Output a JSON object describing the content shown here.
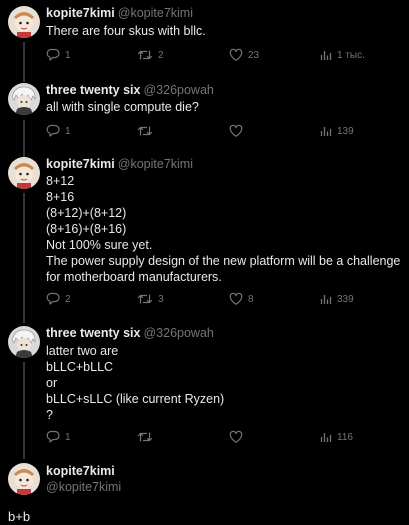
{
  "tweets": [
    {
      "name": "kopite7kimi",
      "handle": "@kopite7kimi",
      "lines": [
        "There are four skus with bllc."
      ],
      "replies": "1",
      "retweets": "2",
      "likes": "23",
      "views": "1 тыс."
    },
    {
      "name": "three twenty six",
      "handle": "@326powah",
      "lines": [
        "all with single compute die?"
      ],
      "replies": "1",
      "retweets": "",
      "likes": "",
      "views": "139"
    },
    {
      "name": "kopite7kimi",
      "handle": "@kopite7kimi",
      "lines": [
        "8+12",
        "8+16",
        "(8+12)+(8+12)",
        "(8+16)+(8+16)",
        "Not 100% sure yet.",
        "The power supply design of the new platform will be a challenge for motherboard manufacturers."
      ],
      "replies": "2",
      "retweets": "3",
      "likes": "8",
      "views": "339"
    },
    {
      "name": "three twenty six",
      "handle": "@326powah",
      "lines": [
        "latter two are",
        "bLLC+bLLC",
        "or",
        "bLLC+sLLC (like current Ryzen)",
        "?"
      ],
      "replies": "1",
      "retweets": "",
      "likes": "",
      "views": "116"
    }
  ],
  "main": {
    "name": "kopite7kimi",
    "handle": "@kopite7kimi",
    "text": "b+b"
  },
  "colors": {
    "background": "#000000",
    "text": "#e7e9ea",
    "muted": "#71767b",
    "thread_line": "#333639"
  },
  "icons": [
    "reply-icon",
    "retweet-icon",
    "like-icon",
    "views-icon"
  ]
}
